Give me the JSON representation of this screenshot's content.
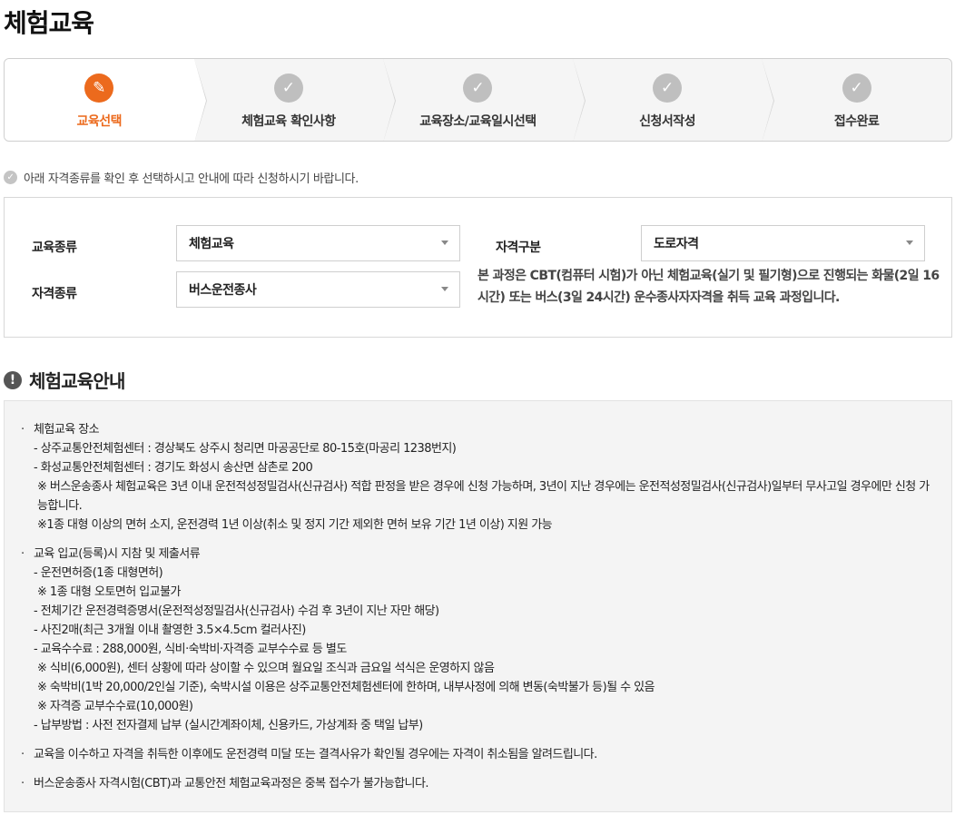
{
  "page_title": "체험교육",
  "steps": [
    {
      "label": "교육선택",
      "icon": "pencil-icon",
      "active": true
    },
    {
      "label": "체험교육 확인사항",
      "icon": "check-icon",
      "active": false
    },
    {
      "label": "교육장소/교육일시선택",
      "icon": "check-icon",
      "active": false
    },
    {
      "label": "신청서작성",
      "icon": "check-icon",
      "active": false
    },
    {
      "label": "접수완료",
      "icon": "check-icon",
      "active": false
    }
  ],
  "notice": "아래 자격종류를 확인 후 선택하시고 안내에 따라 신청하시기 바랍니다.",
  "form": {
    "edu_type_label": "교육종류",
    "edu_type_value": "체험교육",
    "qual_class_label": "자격구분",
    "qual_class_value": "도로자격",
    "qual_type_label": "자격종류",
    "qual_type_value": "버스운전종사",
    "description": "본 과정은 CBT(컴퓨터 시험)가 아닌 체험교육(실기 및 필기형)으로 진행되는 화물(2일 16시간) 또는 버스(3일 24시간) 운수종사자자격을 취득 교육 과정입니다."
  },
  "guide": {
    "title": "체험교육안내",
    "location_head": "체험교육 장소",
    "location_1": "- 상주교통안전체험센터 : 경상북도 상주시 청리면 마공공단로 80-15호(마공리 1238번지)",
    "location_2": "- 화성교통안전체험센터 : 경기도 화성시 송산면 삼촌로 200",
    "location_note_1": "※ 버스운송종사 체험교육은 3년 이내 운전적성정밀검사(신규검사) 적합 판정을 받은 경우에 신청 가능하며, 3년이 지난 경우에는 운전적성정밀검사(신규검사)일부터 무사고일 경우에만 신청 가능합니다.",
    "location_note_2": "※1종 대형 이상의 면허 소지, 운전경력 1년 이상(취소 및 정지 기간 제외한 면허 보유 기간 1년 이상) 지원 가능",
    "docs_head": "교육 입교(등록)시 지참 및 제출서류",
    "docs_1": "- 운전면허증(1종 대형면허)",
    "docs_1_note": "※ 1종 대형 오토면허 입교불가",
    "docs_2": "- 전체기간 운전경력증명서(운전적성정밀검사(신규검사) 수검 후 3년이 지난 자만 해당)",
    "docs_3": "- 사진2매(최근 3개월 이내 촬영한 3.5×4.5cm 컬러사진)",
    "docs_4": "- 교육수수료 : 288,000원, 식비·숙박비·자격증 교부수수료 등 별도",
    "docs_4_note_1": "※ 식비(6,000원), 센터 상황에 따라 상이할 수 있으며 월요일 조식과 금요일 석식은 운영하지 않음",
    "docs_4_note_2": "※ 숙박비(1박 20,000/2인실 기준), 숙박시설 이용은 상주교통안전체험센터에 한하며, 내부사정에 의해 변동(숙박불가 등)될 수 있음",
    "docs_4_note_3": "※ 자격증 교부수수료(10,000원)",
    "docs_5": "- 납부방법 : 사전 전자결제 납부 (실시간계좌이체, 신용카드, 가상계좌 중 택일 납부)",
    "cancel_notice": "교육을 이수하고 자격을 취득한 이후에도 운전경력 미달 또는 결격사유가 확인될 경우에는 자격이 취소됨을 알려드립니다.",
    "duplicate_notice": "버스운송종사 자격시험(CBT)과 교통안전 체험교육과정은 중복 접수가 불가능합니다."
  }
}
